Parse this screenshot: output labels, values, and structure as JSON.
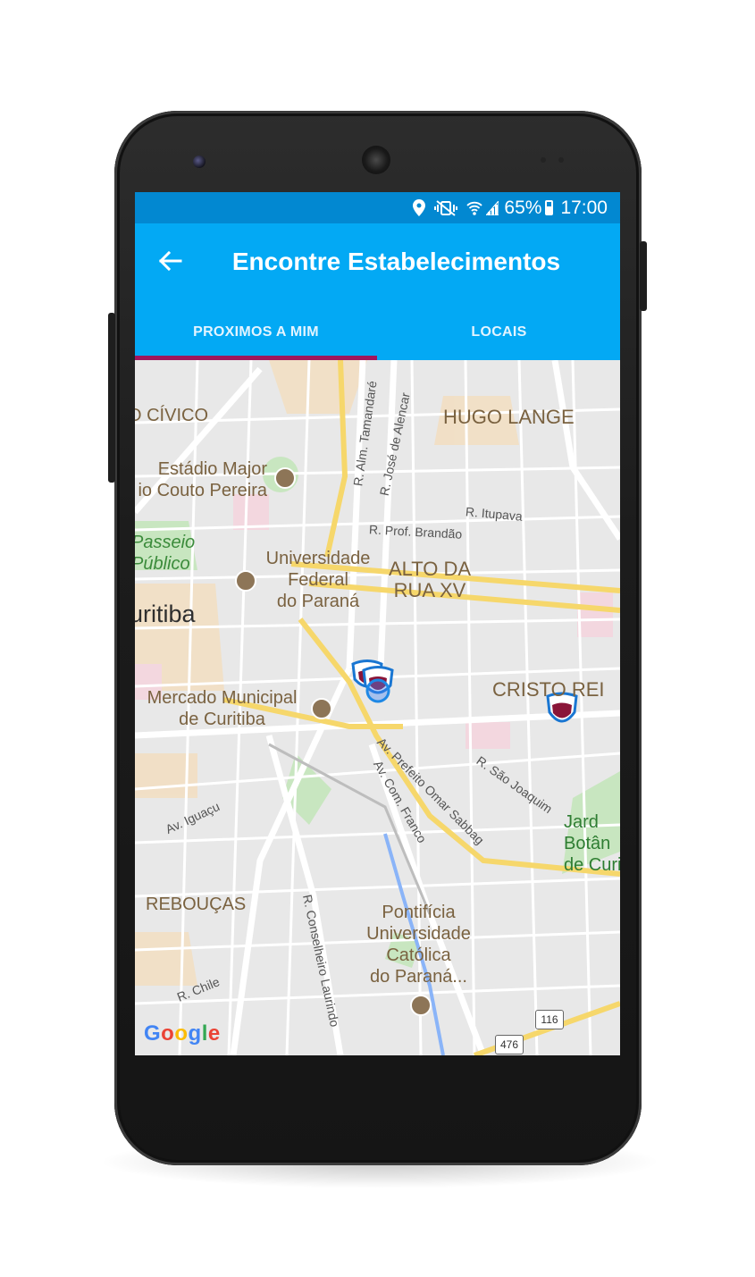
{
  "status_bar": {
    "battery": "65%",
    "time": "17:00"
  },
  "app_bar": {
    "title": "Encontre Estabelecimentos"
  },
  "tabs": [
    {
      "label": "PROXIMOS A MIM",
      "active": true
    },
    {
      "label": "LOCAIS",
      "active": false
    }
  ],
  "map": {
    "neighborhoods": {
      "civico": "O CÍVICO",
      "hugo_lange": "HUGO LANGE",
      "alto_da_rua_xv": "ALTO DA\nRUA XV",
      "cristo_rei": "CRISTO REI",
      "reboucas": "REBOUÇAS"
    },
    "city": "uritiba",
    "places": {
      "estadio": "Estádio Major\nio Couto Pereira",
      "universidade": "Universidade\nFederal\ndo Paraná",
      "mercado": "Mercado Municipal\nde Curitiba",
      "pontificia": "Pontifícia\nUniversidade\nCatólica\ndo Paraná...",
      "passeio": "Passeio\nPúblico",
      "jardim": "Jard\nBotân\nde Curi"
    },
    "streets": {
      "tamandare": "R. Alm. Tamandaré",
      "alencar": "R. José de Alencar",
      "itupava": "R. Itupava",
      "brandao": "R. Prof. Brandão",
      "sabbag": "Av. Prefeito Omar Sabbag",
      "franco": "Av. Com. Franco",
      "sao_joaquim": "R. São Joaquim",
      "iguacu": "Av. Iguaçu",
      "conselheiro": "R. Conselheiro Laurindo",
      "chile": "R. Chile"
    },
    "shields": [
      "116",
      "476"
    ],
    "attribution": "Google",
    "colors": {
      "accent": "#03a9f4",
      "status_bar": "#0288d1",
      "tab_indicator": "#a0155c"
    }
  }
}
